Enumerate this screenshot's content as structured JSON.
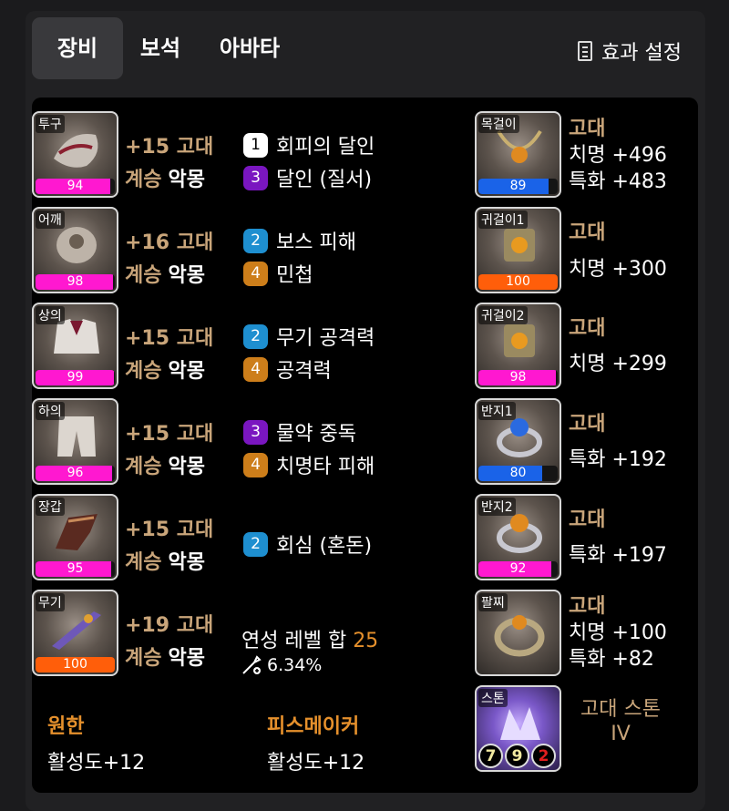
{
  "tabs": [
    {
      "label": "장비",
      "active": true
    },
    {
      "label": "보석",
      "active": false
    },
    {
      "label": "아바타",
      "active": false
    }
  ],
  "settings_label": "효과 설정",
  "equipment": [
    {
      "slot": "투구",
      "quality": 94,
      "quality_color": "#ff18d0",
      "refine": "+15 고대",
      "succ_label": "계승",
      "succ_value": "악몽",
      "engravings": [
        {
          "level": "1",
          "name": "회피의 달인",
          "color": "white"
        },
        {
          "level": "3",
          "name": "달인 (질서)",
          "color": "purple"
        }
      ]
    },
    {
      "slot": "어깨",
      "quality": 98,
      "quality_color": "#ff18d0",
      "refine": "+16 고대",
      "succ_label": "계승",
      "succ_value": "악몽",
      "engravings": [
        {
          "level": "2",
          "name": "보스 피해",
          "color": "blue"
        },
        {
          "level": "4",
          "name": "민첩",
          "color": "orange"
        }
      ]
    },
    {
      "slot": "상의",
      "quality": 99,
      "quality_color": "#ff18d0",
      "refine": "+15 고대",
      "succ_label": "계승",
      "succ_value": "악몽",
      "engravings": [
        {
          "level": "2",
          "name": "무기 공격력",
          "color": "blue"
        },
        {
          "level": "4",
          "name": "공격력",
          "color": "orange"
        }
      ]
    },
    {
      "slot": "하의",
      "quality": 96,
      "quality_color": "#ff18d0",
      "refine": "+15 고대",
      "succ_label": "계승",
      "succ_value": "악몽",
      "engravings": [
        {
          "level": "3",
          "name": "물약 중독",
          "color": "purple"
        },
        {
          "level": "4",
          "name": "치명타 피해",
          "color": "orange"
        }
      ]
    },
    {
      "slot": "장갑",
      "quality": 95,
      "quality_color": "#ff18d0",
      "refine": "+15 고대",
      "succ_label": "계승",
      "succ_value": "악몽",
      "engravings": [
        {
          "level": "2",
          "name": "회심 (혼돈)",
          "color": "blue"
        }
      ]
    },
    {
      "slot": "무기",
      "quality": 100,
      "quality_color": "#ff5e0a",
      "refine": "+19 고대",
      "succ_label": "계승",
      "succ_value": "악몽",
      "engravings": []
    }
  ],
  "transcendence": {
    "label": "연성 레벨 합",
    "value": "25",
    "percent": "6.34%"
  },
  "bracelet_effects": [
    {
      "name": "원한",
      "value": "활성도+12"
    },
    {
      "name": "피스메이커",
      "value": "활성도+12"
    }
  ],
  "accessories": [
    {
      "slot": "목걸이",
      "quality": 89,
      "quality_color": "#1a63e8",
      "grade": "고대",
      "stats": [
        "치명 +496",
        "특화 +483"
      ]
    },
    {
      "slot": "귀걸이1",
      "quality": 100,
      "quality_color": "#ff5e0a",
      "grade": "고대",
      "stats": [
        "치명 +300"
      ]
    },
    {
      "slot": "귀걸이2",
      "quality": 98,
      "quality_color": "#ff18d0",
      "grade": "고대",
      "stats": [
        "치명 +299"
      ]
    },
    {
      "slot": "반지1",
      "quality": 80,
      "quality_color": "#1a63e8",
      "grade": "고대",
      "stats": [
        "특화 +192"
      ]
    },
    {
      "slot": "반지2",
      "quality": 92,
      "quality_color": "#ff18d0",
      "grade": "고대",
      "stats": [
        "특화 +197"
      ]
    },
    {
      "slot": "팔찌",
      "grade": "고대",
      "stats": [
        "치명 +100",
        "특화 +82"
      ]
    }
  ],
  "stone": {
    "slot": "스톤",
    "name_line1": "고대 스톤",
    "name_line2": "IV",
    "levels": [
      "7",
      "9",
      "2"
    ],
    "level_colors": [
      "#f2e9a0",
      "#f2e9a0",
      "#e01e1e"
    ]
  }
}
